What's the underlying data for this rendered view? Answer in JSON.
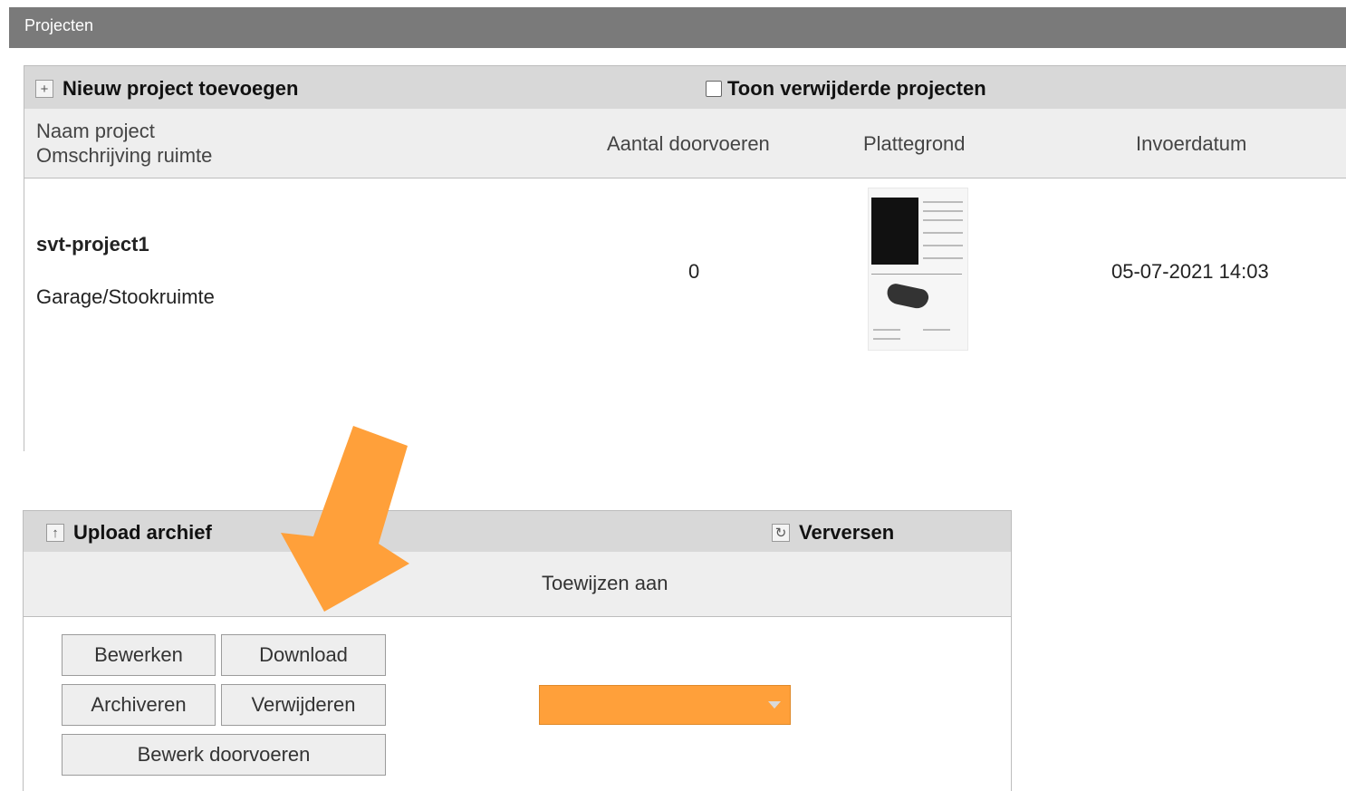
{
  "window": {
    "title": "Projecten"
  },
  "projects": {
    "toolbar": {
      "add_label": "Nieuw project toevoegen",
      "add_icon": "plus-icon",
      "show_deleted_label": "Toon verwijderde projecten",
      "show_deleted_checked": false
    },
    "columns": {
      "name_line1": "Naam project",
      "name_line2": "Omschrijving ruimte",
      "count": "Aantal doorvoeren",
      "floorplan": "Plattegrond",
      "date": "Invoerdatum"
    },
    "rows": [
      {
        "name": "svt-project1",
        "description": "Garage/Stookruimte",
        "count": "0",
        "date": "05-07-2021 14:03"
      }
    ]
  },
  "archive": {
    "toolbar": {
      "upload_label": "Upload archief",
      "upload_icon": "upload-arrow-icon",
      "refresh_label": "Verversen",
      "refresh_icon": "refresh-icon"
    },
    "assign_header": "Toewijzen aan",
    "buttons": {
      "edit": "Bewerken",
      "download": "Download",
      "archive": "Archiveren",
      "delete": "Verwijderen",
      "edit_passthroughs": "Bewerk doorvoeren"
    },
    "assign_select": {
      "value": "",
      "color": "#ffa03a"
    }
  },
  "annotation": {
    "arrow_color": "#ffa03a",
    "arrow_icon": "pointer-arrow-icon"
  }
}
